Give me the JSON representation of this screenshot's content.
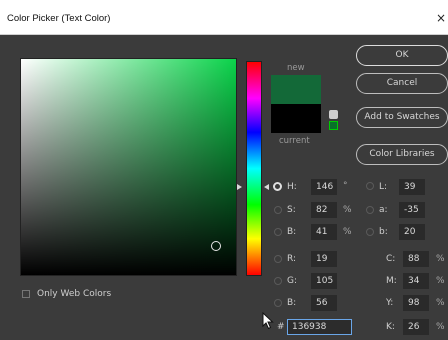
{
  "window": {
    "title": "Color Picker (Text Color)",
    "close_glyph": "×"
  },
  "swatch": {
    "new_label": "new",
    "current_label": "current",
    "new_color": "#136938",
    "current_color": "#000000"
  },
  "buttons": {
    "ok": "OK",
    "cancel": "Cancel",
    "add_swatches": "Add to Swatches",
    "color_libraries": "Color Libraries"
  },
  "fields": {
    "hsb": [
      {
        "label": "H:",
        "value": "146",
        "unit": "°"
      },
      {
        "label": "S:",
        "value": "82",
        "unit": "%"
      },
      {
        "label": "B:",
        "value": "41",
        "unit": "%"
      }
    ],
    "rgb": [
      {
        "label": "R:",
        "value": "19"
      },
      {
        "label": "G:",
        "value": "105"
      },
      {
        "label": "B:",
        "value": "56"
      }
    ],
    "lab": [
      {
        "label": "L:",
        "value": "39"
      },
      {
        "label": "a:",
        "value": "-35"
      },
      {
        "label": "b:",
        "value": "20"
      }
    ],
    "cmyk": [
      {
        "label": "C:",
        "value": "88",
        "unit": "%"
      },
      {
        "label": "M:",
        "value": "34",
        "unit": "%"
      },
      {
        "label": "Y:",
        "value": "98",
        "unit": "%"
      },
      {
        "label": "K:",
        "value": "26",
        "unit": "%"
      }
    ],
    "hex": {
      "label": "#",
      "value": "136938"
    }
  },
  "options": {
    "only_web_colors": "Only Web Colors"
  },
  "icons": {
    "gamut": "cube-icon",
    "websafe": "websafe-swatch-icon",
    "pointer": "mouse-pointer-icon"
  }
}
